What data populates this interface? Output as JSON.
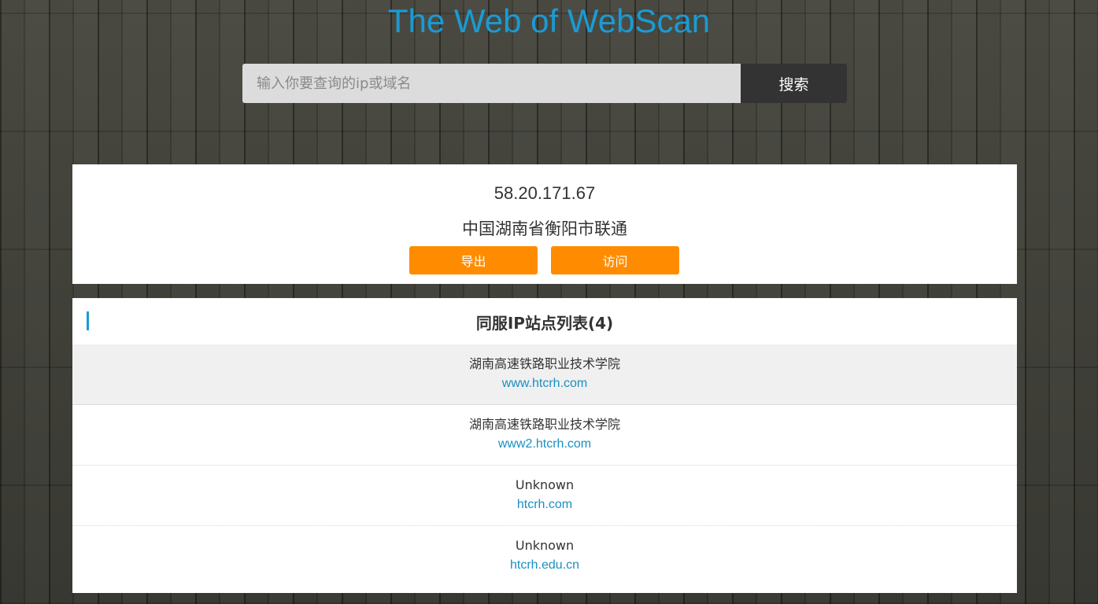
{
  "header": {
    "title": "The Web of WebScan"
  },
  "search": {
    "placeholder": "输入你要查询的ip或域名",
    "value": "",
    "button_label": "搜索"
  },
  "ip_info": {
    "ip": "58.20.171.67",
    "location": "中国湖南省衡阳市联通",
    "export_label": "导出",
    "visit_label": "访问"
  },
  "site_list": {
    "title": "同服IP站点列表(4)",
    "items": [
      {
        "name": "湖南高速铁路职业技术学院",
        "domain": "www.htcrh.com"
      },
      {
        "name": "湖南高速铁路职业技术学院",
        "domain": "www2.htcrh.com"
      },
      {
        "name": "Unknown",
        "domain": "htcrh.com"
      },
      {
        "name": "Unknown",
        "domain": "htcrh.edu.cn"
      }
    ]
  },
  "colors": {
    "accent": "#1a9bd4",
    "button_orange": "#ff8c00",
    "search_button": "#333333"
  }
}
